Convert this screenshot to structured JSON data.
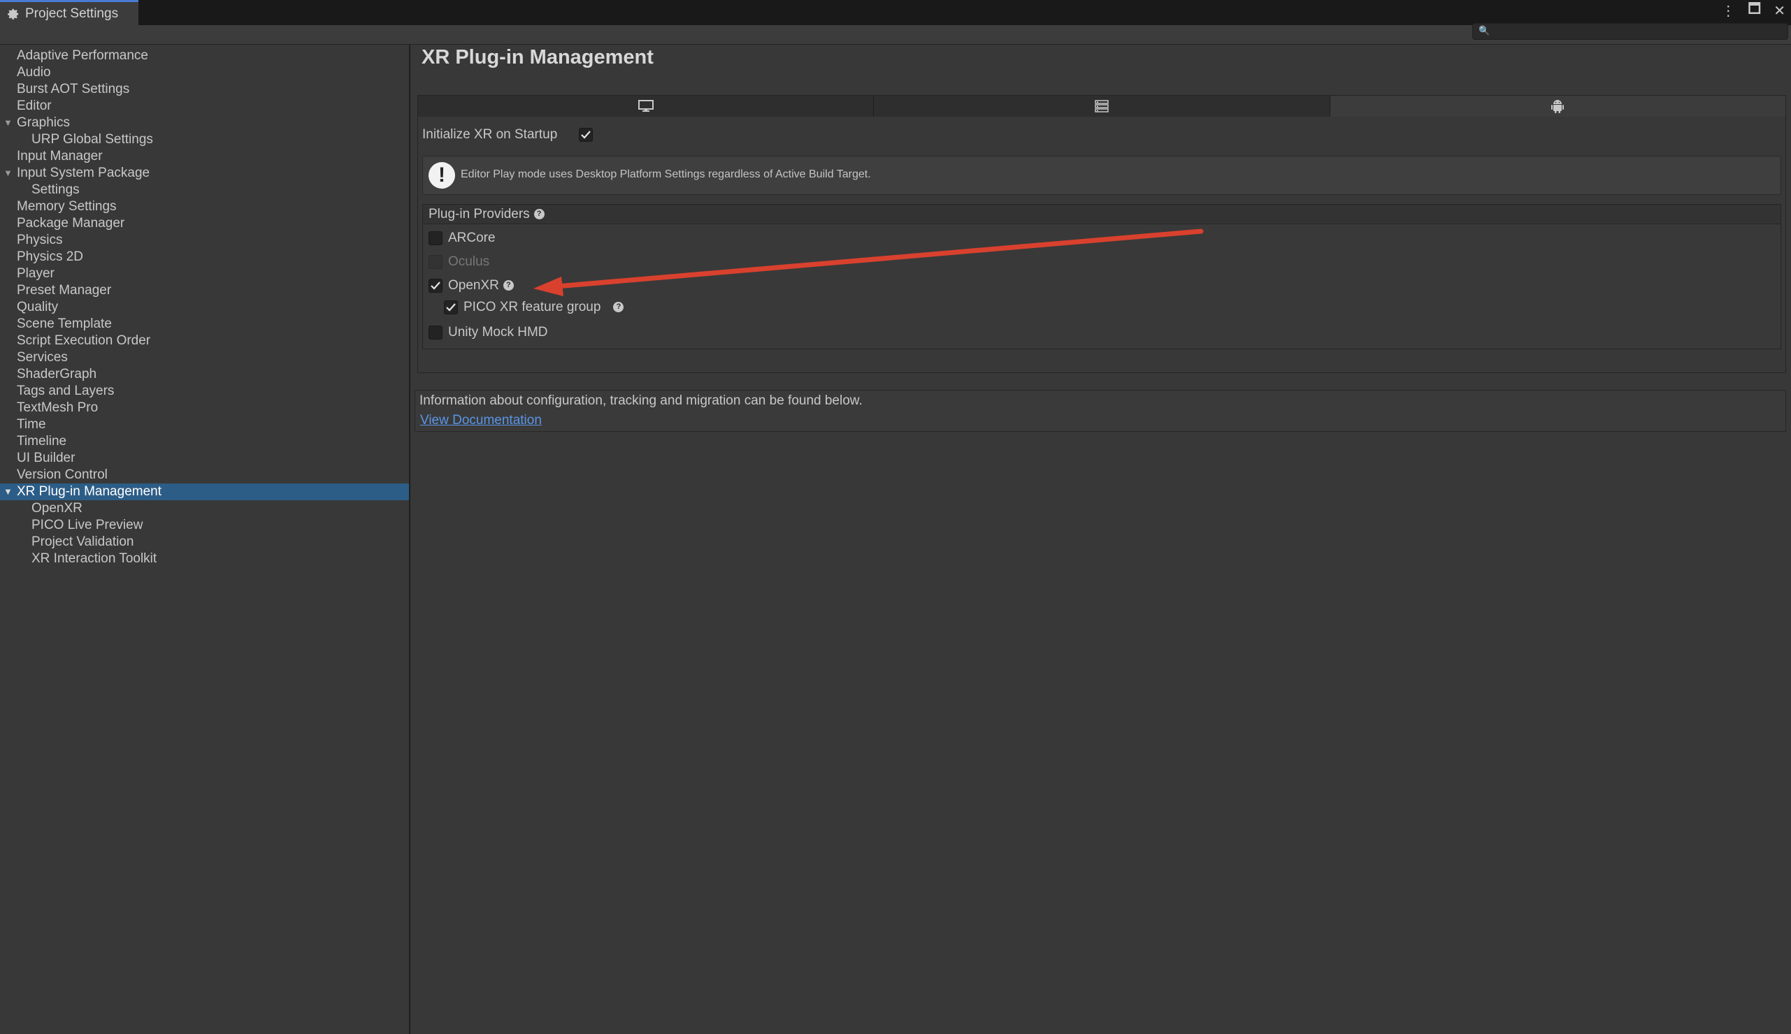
{
  "window": {
    "tab_title": "Project Settings"
  },
  "sidebar": {
    "items": [
      {
        "label": "Adaptive Performance"
      },
      {
        "label": "Audio"
      },
      {
        "label": "Burst AOT Settings"
      },
      {
        "label": "Editor"
      },
      {
        "label": "Graphics"
      },
      {
        "label": "URP Global Settings"
      },
      {
        "label": "Input Manager"
      },
      {
        "label": "Input System Package"
      },
      {
        "label": "Settings"
      },
      {
        "label": "Memory Settings"
      },
      {
        "label": "Package Manager"
      },
      {
        "label": "Physics"
      },
      {
        "label": "Physics 2D"
      },
      {
        "label": "Player"
      },
      {
        "label": "Preset Manager"
      },
      {
        "label": "Quality"
      },
      {
        "label": "Scene Template"
      },
      {
        "label": "Script Execution Order"
      },
      {
        "label": "Services"
      },
      {
        "label": "ShaderGraph"
      },
      {
        "label": "Tags and Layers"
      },
      {
        "label": "TextMesh Pro"
      },
      {
        "label": "Time"
      },
      {
        "label": "Timeline"
      },
      {
        "label": "UI Builder"
      },
      {
        "label": "Version Control"
      },
      {
        "label": "XR Plug-in Management"
      },
      {
        "label": "OpenXR"
      },
      {
        "label": "PICO Live Preview"
      },
      {
        "label": "Project Validation"
      },
      {
        "label": "XR Interaction Toolkit"
      }
    ],
    "selected": "XR Plug-in Management"
  },
  "main": {
    "title": "XR Plug-in Management",
    "platform_tabs": [
      {
        "icon": "monitor-icon"
      },
      {
        "icon": "server-icon"
      },
      {
        "icon": "android-icon",
        "active": true
      }
    ],
    "init_label": "Initialize XR on Startup",
    "init_checked": true,
    "warning_text": "Editor Play mode uses Desktop Platform Settings regardless of Active Build Target.",
    "providers": {
      "header": "Plug-in Providers",
      "items": [
        {
          "label": "ARCore",
          "checked": false
        },
        {
          "label": "Oculus",
          "checked": false,
          "disabled": true
        },
        {
          "label": "OpenXR",
          "checked": true
        },
        {
          "label": "PICO XR feature group",
          "checked": true
        },
        {
          "label": "Unity Mock HMD",
          "checked": false
        }
      ]
    },
    "info_text": "Information about configuration, tracking and migration can be found below.",
    "doc_link": "View Documentation"
  },
  "colors": {
    "selection": "#2c5d87",
    "annotation_arrow": "#d9412e",
    "link": "#5a96e6"
  }
}
